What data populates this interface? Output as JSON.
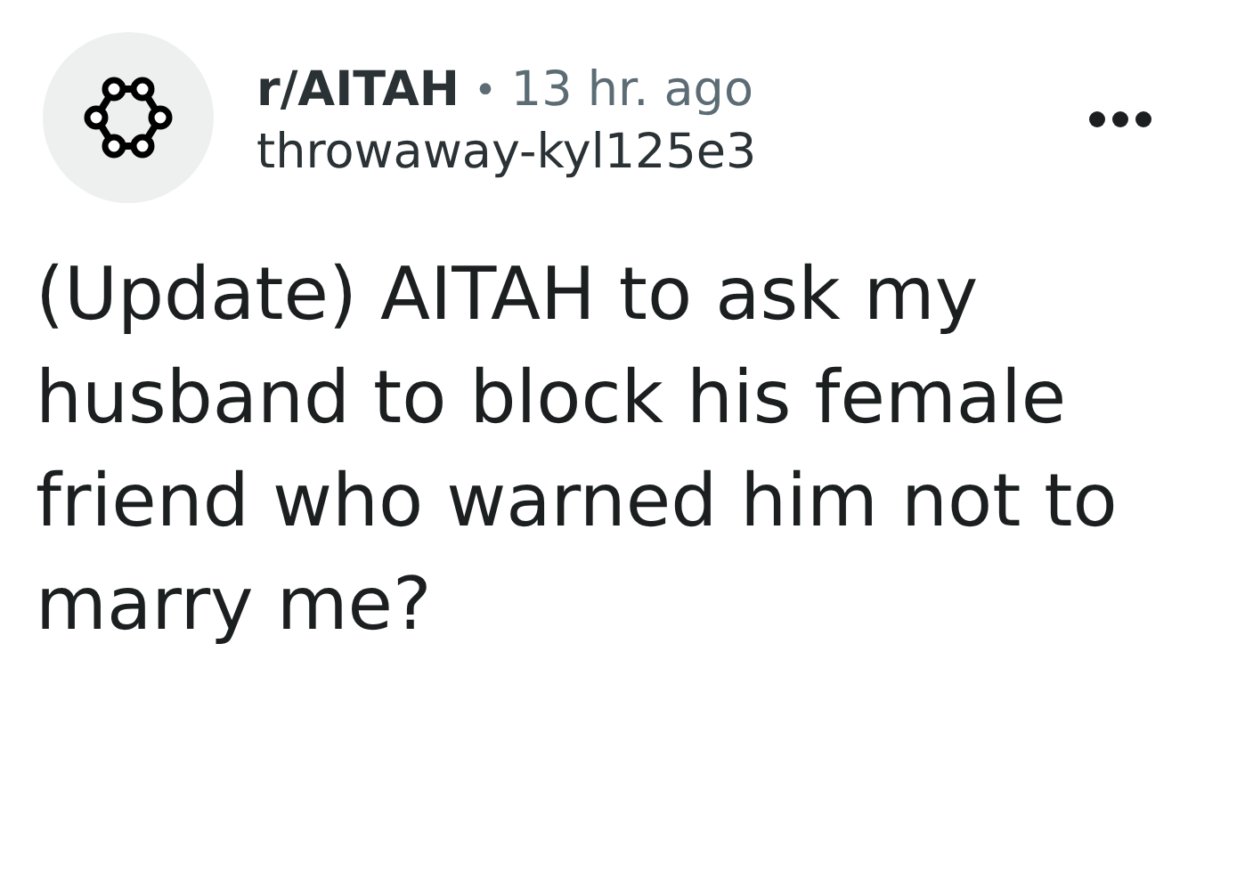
{
  "post": {
    "subreddit": "r/AITAH",
    "separator": "•",
    "time": "13 hr. ago",
    "author": "throwaway-kyl125e3",
    "title": "(Update) AITAH to ask my husband to block his female friend who warned him not to marry me?"
  }
}
